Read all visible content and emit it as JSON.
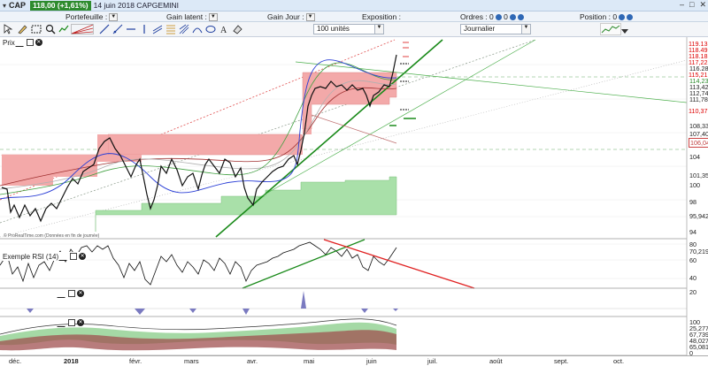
{
  "titlebar": {
    "symbol": "CAP",
    "price_change": "118,00 (+1,61%)",
    "date_name": "14 juin 2018 CAPGEMINI"
  },
  "info": {
    "portefeuille": "Portefeuille :",
    "gain_latent": "Gain latent :",
    "gain_jour": "Gain Jour :",
    "exposition": "Exposition :",
    "ordres": "Ordres : 0",
    "ordres_count": "0",
    "position": "Position : 0"
  },
  "toolbar": {
    "units": "100 unités",
    "period": "Journalier"
  },
  "panels": {
    "price": "Prix",
    "rsi": "Exemple RSI (14)",
    "watermark": "© ProRealTime.com (Données en fin de journée)"
  },
  "price_axis": [
    "119,13",
    "118,49",
    "118,18",
    "117,22",
    "116,28",
    "115,21",
    "114,23",
    "113,42",
    "112,74",
    "111,78",
    "110,37",
    "108,33",
    "107,40",
    "106,04",
    "104",
    "101,35",
    "100",
    "98",
    "95,942",
    "94"
  ],
  "rsi_axis": [
    "80",
    "70,219",
    "60",
    "40",
    "20"
  ],
  "osc_axis": [
    "100",
    "25,277",
    "67,739",
    "48,027",
    "65,081",
    "0"
  ],
  "x_axis": [
    "déc.",
    "2018",
    "févr.",
    "mars",
    "avr.",
    "mai",
    "juin",
    "juil.",
    "août",
    "sept.",
    "oct."
  ],
  "colors": {
    "up_cloud": "#f3a9a9",
    "down_cloud": "#a9e0a9",
    "price_line": "#111111",
    "ma_blue": "#2b3fd6",
    "trend_green": "#1a8a1a",
    "rsi_trend_red": "#e02020"
  }
}
